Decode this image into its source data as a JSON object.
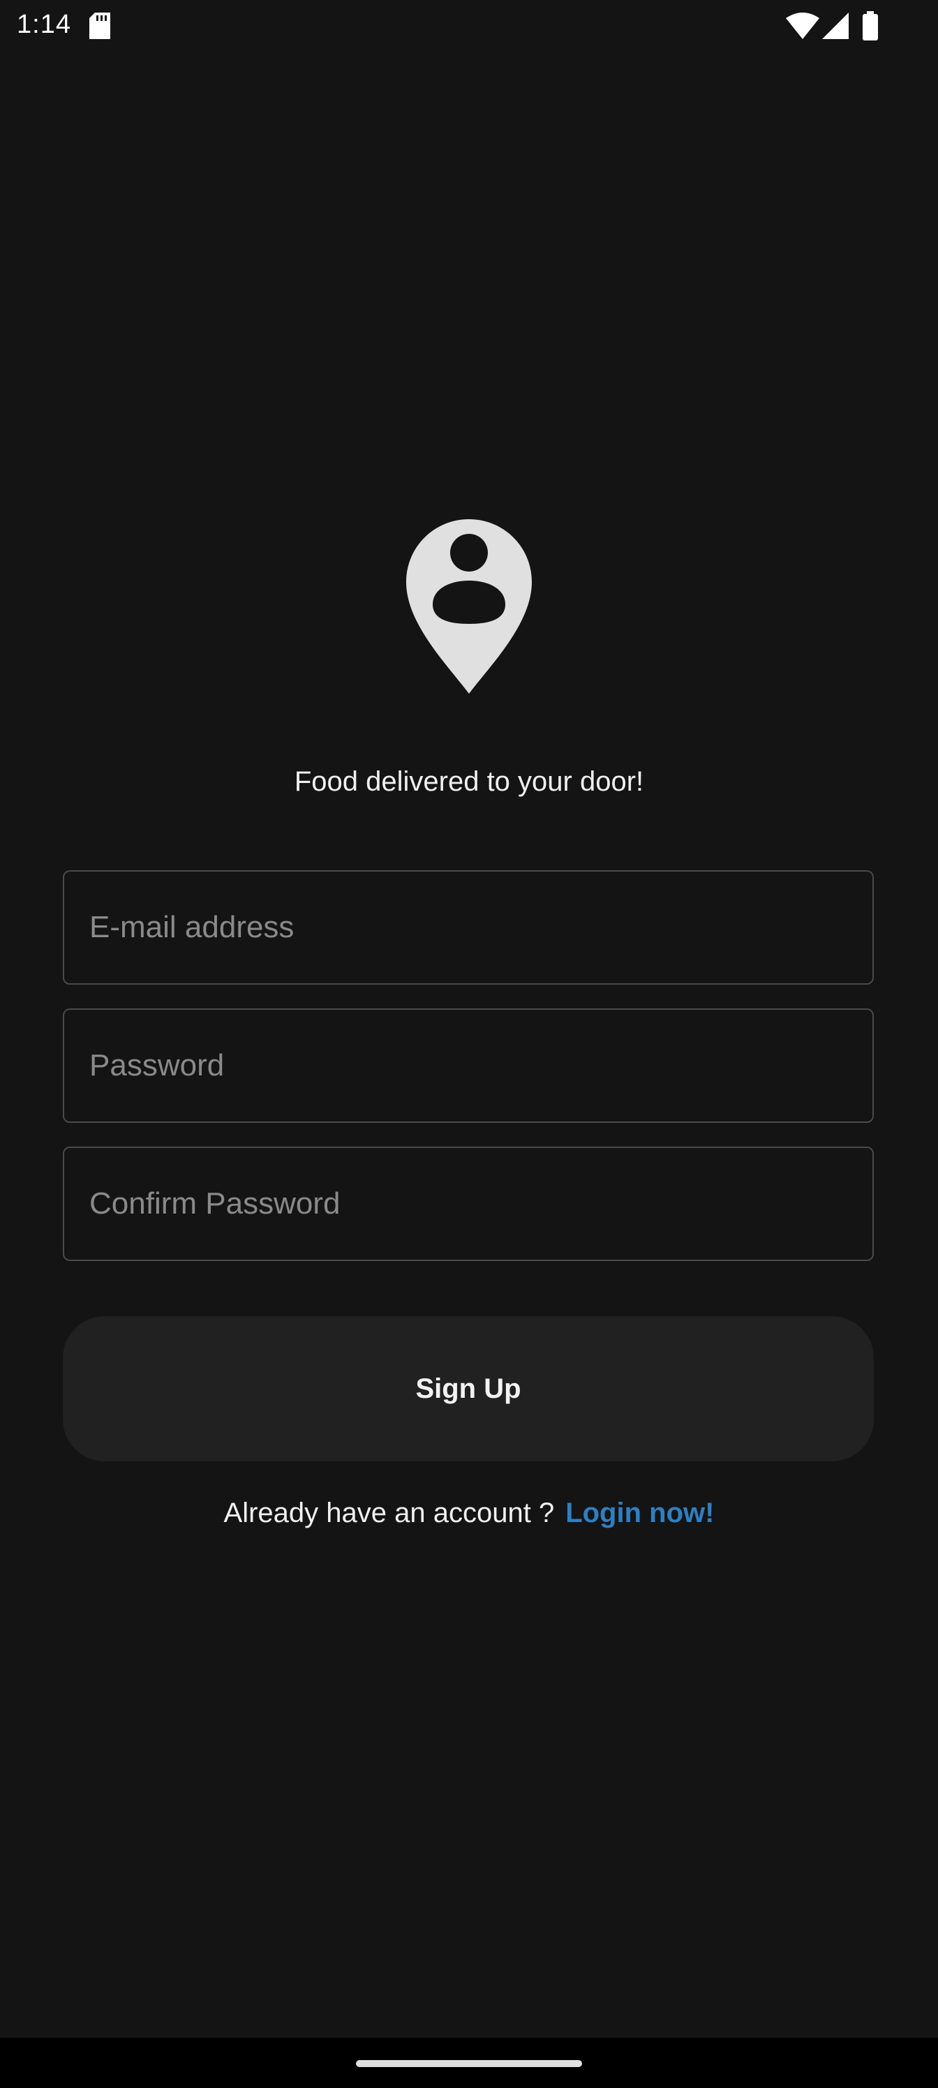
{
  "status_bar": {
    "time": "1:14",
    "icons": [
      "sd-card-icon",
      "wifi-icon",
      "signal-icon",
      "battery-icon"
    ]
  },
  "logo": {
    "icon": "location-person-pin-icon",
    "color": "#e0e0e0"
  },
  "tagline": "Food delivered to your door!",
  "form": {
    "email": {
      "placeholder": "E-mail address",
      "value": ""
    },
    "password": {
      "placeholder": "Password",
      "value": ""
    },
    "confirm_password": {
      "placeholder": "Confirm Password",
      "value": ""
    },
    "signup_label": "Sign Up"
  },
  "login": {
    "prompt": "Already have an account ?",
    "link": "Login now!"
  },
  "colors": {
    "background": "#141414",
    "button_background": "#212121",
    "link": "#2f7fc1",
    "field_border": "#4a4a4a"
  }
}
